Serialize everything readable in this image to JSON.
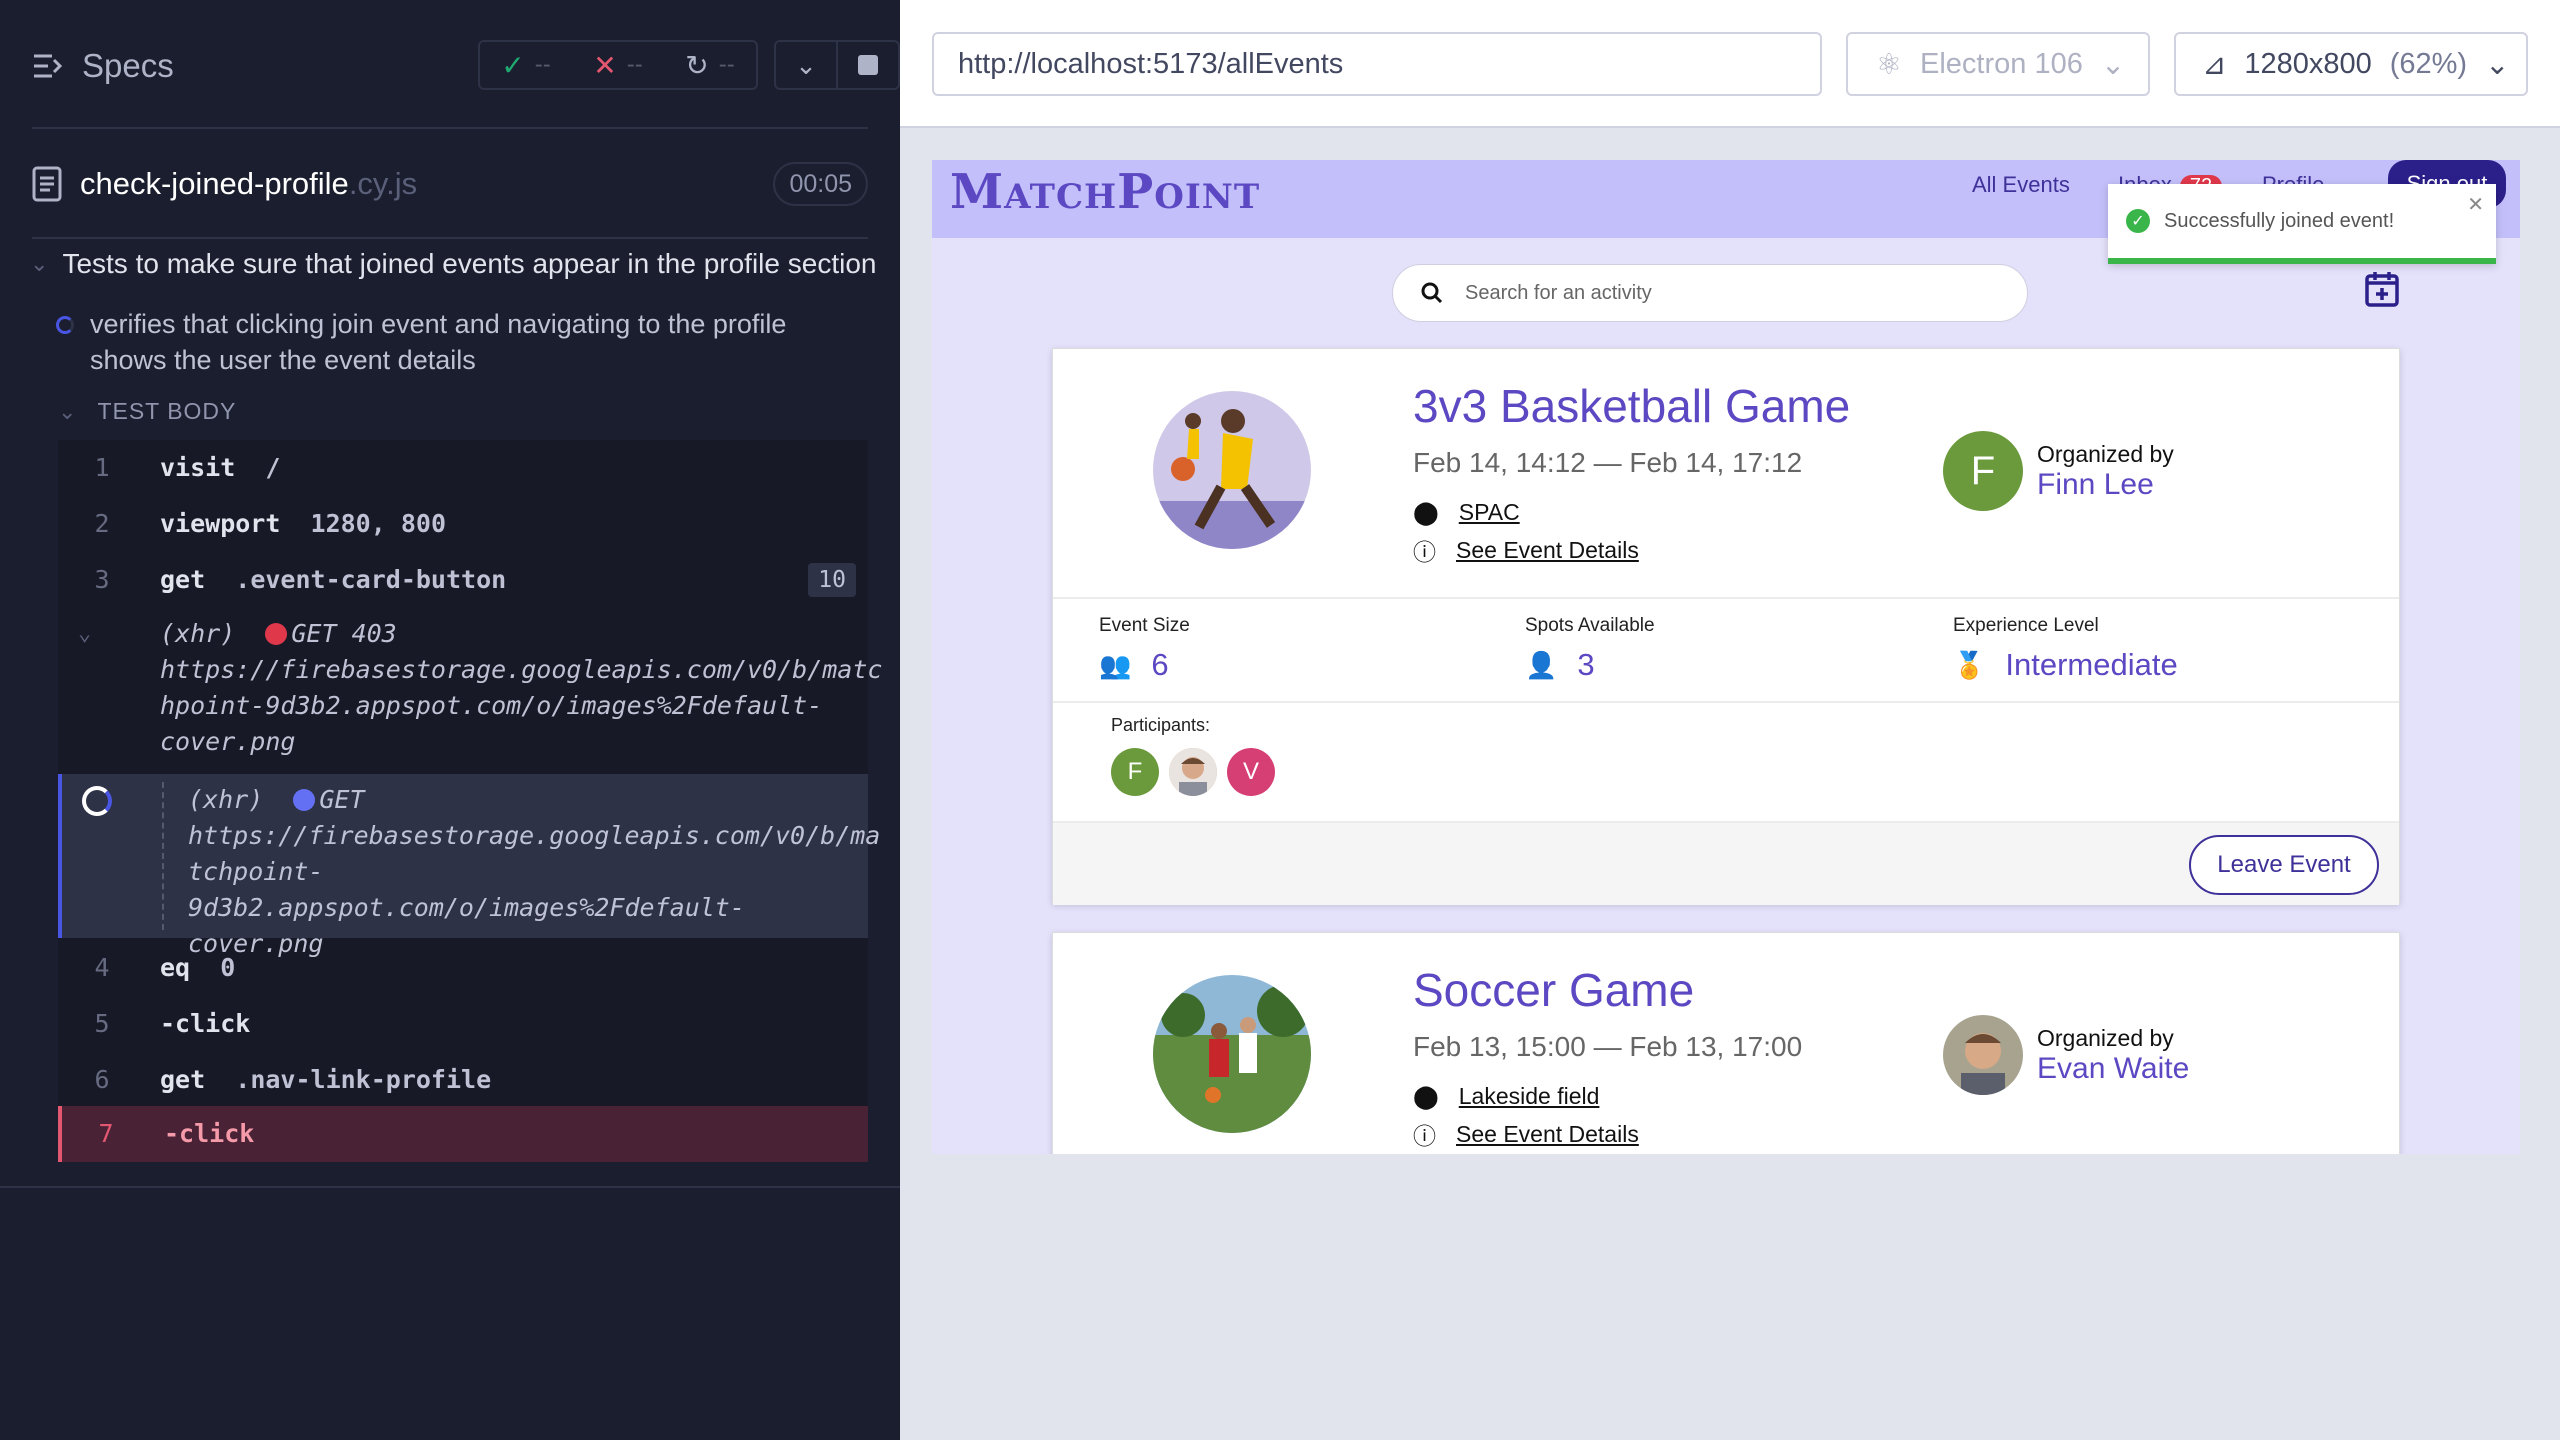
{
  "reporter": {
    "specs_label": "Specs",
    "passed": "--",
    "failed": "--",
    "pending": "--",
    "file_name": "check-joined-profile",
    "file_ext": ".cy.js",
    "timer": "00:05",
    "suite_title": "Tests to make sure that joined events appear in the profile section",
    "test_title": "verifies that clicking join event and navigating to the profile shows the user the event details",
    "test_body_label": "TEST BODY",
    "commands": [
      {
        "num": "1",
        "name": "visit",
        "message": "/"
      },
      {
        "num": "2",
        "name": "viewport",
        "message": "1280, 800"
      },
      {
        "num": "3",
        "name": "get",
        "message": ".event-card-button",
        "badge": "10"
      },
      {
        "num": "4",
        "name": "eq",
        "message": "0"
      },
      {
        "num": "5",
        "name": "-click",
        "message": ""
      },
      {
        "num": "6",
        "name": "get",
        "message": ".nav-link-profile"
      },
      {
        "num": "7",
        "name": "-click",
        "message": ""
      }
    ],
    "xhr1": {
      "label": "(xhr)",
      "method_status": "GET 403",
      "url_lines": [
        "https://firebasestorage.googleapis.com/v0/b/matc",
        "hpoint-9d3b2.appspot.com/o/images%2Fdefault-",
        "cover.png"
      ]
    },
    "xhr2": {
      "label": "(xhr)",
      "method_status": "GET",
      "url_lines": [
        "https://firebasestorage.googleapis.com/v0/b/ma",
        "tchpoint-9d3b2.appspot.com/o/images%2Fdefault-",
        "cover.png"
      ]
    },
    "colors": {
      "failed_dot": "#e0384b",
      "pending_dot": "#6470f3"
    }
  },
  "browser": {
    "url": "http://localhost:5173/allEvents",
    "browser_name": "Electron 106",
    "viewport": "1280x800",
    "zoom": "(62%)"
  },
  "app": {
    "logo": "MatchPoint",
    "nav": {
      "all_events": "All Events",
      "inbox": "Inbox",
      "inbox_count": "72",
      "profile": "Profile",
      "sign_out": "Sign out"
    },
    "toast": "Successfully joined event!",
    "search_placeholder": "Search for an activity",
    "events": [
      {
        "title": "3v3 Basketball Game",
        "dates": "Feb 14, 14:12 — Feb 14, 17:12",
        "location": "SPAC",
        "details_link": "See Event Details",
        "organized_by_label": "Organized by",
        "organizer": "Finn Lee",
        "organizer_initial": "F",
        "event_size_label": "Event Size",
        "event_size": "6",
        "spots_label": "Spots Available",
        "spots": "3",
        "experience_label": "Experience Level",
        "experience": "Intermediate",
        "participants_label": "Participants:",
        "participants": [
          "F",
          "",
          "V"
        ],
        "leave_button": "Leave Event"
      },
      {
        "title": "Soccer Game",
        "dates": "Feb 13, 15:00 — Feb 13, 17:00",
        "location": "Lakeside field",
        "details_link": "See Event Details",
        "organized_by_label": "Organized by",
        "organizer": "Evan Waite"
      }
    ],
    "colors": {
      "accent": "#5b48c2",
      "navbar": "#c3bffa",
      "background": "#e4e1fb"
    }
  }
}
